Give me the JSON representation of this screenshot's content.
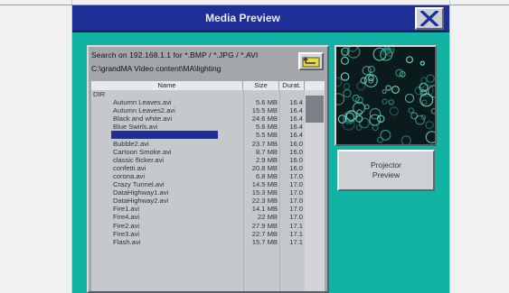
{
  "window": {
    "title": "Media Preview"
  },
  "browser": {
    "search_line": "Search on 192.168.1.1 for *.BMP / *.JPG / *.AVI",
    "path": "C:\\grandMA Video content\\MA\\lighting",
    "columns": {
      "name": "Name",
      "size": "Size",
      "duration": "Durat."
    },
    "parent_dir": "DIR",
    "files": [
      {
        "name": "Autumn Leaves.avi",
        "size": "5.6 MB",
        "duration": "16.4"
      },
      {
        "name": "Autumn Leaves2.avi",
        "size": "15.5 MB",
        "duration": "16.4"
      },
      {
        "name": "Black and white.avi",
        "size": "24.6 MB",
        "duration": "16.4"
      },
      {
        "name": "Blue Swirls.avi",
        "size": "5.6 MB",
        "duration": "16.4"
      },
      {
        "name": "",
        "size": "5.5 MB",
        "duration": "16.4",
        "selected": true
      },
      {
        "name": "Bubble2.avi",
        "size": "23.7 MB",
        "duration": "16.0"
      },
      {
        "name": "Cartoon Smoke.avi",
        "size": "8.7 MB",
        "duration": "16.0"
      },
      {
        "name": "classic flicker.avi",
        "size": "2.9 MB",
        "duration": "16.0"
      },
      {
        "name": "confetti.avi",
        "size": "20.8 MB",
        "duration": "16.0"
      },
      {
        "name": "corona.avi",
        "size": "6.8 MB",
        "duration": "17.0"
      },
      {
        "name": "Crazy Tunnel.avi",
        "size": "14.5 MB",
        "duration": "17.0"
      },
      {
        "name": "DataHighway1.avi",
        "size": "15.3 MB",
        "duration": "17.0"
      },
      {
        "name": "DataHighway2.avi",
        "size": "22.3 MB",
        "duration": "17.0"
      },
      {
        "name": "Fire1.avi",
        "size": "14.1 MB",
        "duration": "17.0"
      },
      {
        "name": "Fire4.avi",
        "size": "22 MB",
        "duration": "17.0"
      },
      {
        "name": "Fire2.avi",
        "size": "27.9 MB",
        "duration": "17.1"
      },
      {
        "name": "Fire3.avi",
        "size": "22.7 MB",
        "duration": "17.1"
      },
      {
        "name": "Flash.avi",
        "size": "15.7 MB",
        "duration": "17.1"
      }
    ]
  },
  "preview": {
    "button_line1": "Projector",
    "button_line2": "Preview"
  },
  "icons": {
    "close": "close-x-icon",
    "folder_up": "folder-up-icon"
  },
  "colors": {
    "title_bar": "#1e2f95",
    "window_bg": "#12b3a2",
    "selection": "#1f2f9a"
  }
}
